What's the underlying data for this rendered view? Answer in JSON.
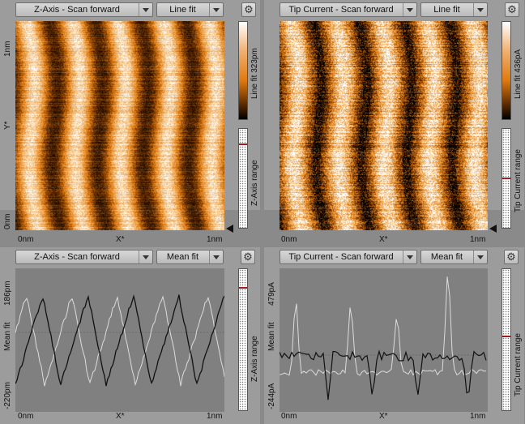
{
  "panels": {
    "tl": {
      "channel": "Z-Axis - Scan forward",
      "filter": "Line fit",
      "y_top": "1nm",
      "y_mid": "Y*",
      "y_bot": "0nm",
      "x_left": "0nm",
      "x_mid": "X*",
      "x_right": "1nm",
      "cbar_label": "Line fit 323pm",
      "range_label": "Z-Axis range"
    },
    "tr": {
      "channel": "Tip Current - Scan forward",
      "filter": "Line fit",
      "cbar_label": "Line fit 436pA",
      "range_label": "Tip Current range",
      "x_left": "0nm",
      "x_mid": "X*",
      "x_right": "1nm"
    },
    "bl": {
      "channel": "Z-Axis - Scan forward",
      "filter": "Mean fit",
      "y_top": "186pm",
      "y_mid": "Mean fit",
      "y_bot": "-220pm",
      "x_left": "0nm",
      "x_mid": "X*",
      "x_right": "1nm",
      "range_label": "Z-Axis range"
    },
    "br": {
      "channel": "Tip Current - Scan forward",
      "filter": "Mean fit",
      "y_top": "479pA",
      "y_mid": "Mean fit",
      "y_bot": "-244pA",
      "x_left": "0nm",
      "x_mid": "X*",
      "x_right": "1nm",
      "range_label": "Tip Current range"
    }
  },
  "icons": {
    "settings": "gear-icon",
    "dropdown": "chevron-down-icon",
    "marker": "triangle-marker-icon"
  },
  "colors": {
    "orange": "#e07a10",
    "bg": "#8a8a8a"
  }
}
